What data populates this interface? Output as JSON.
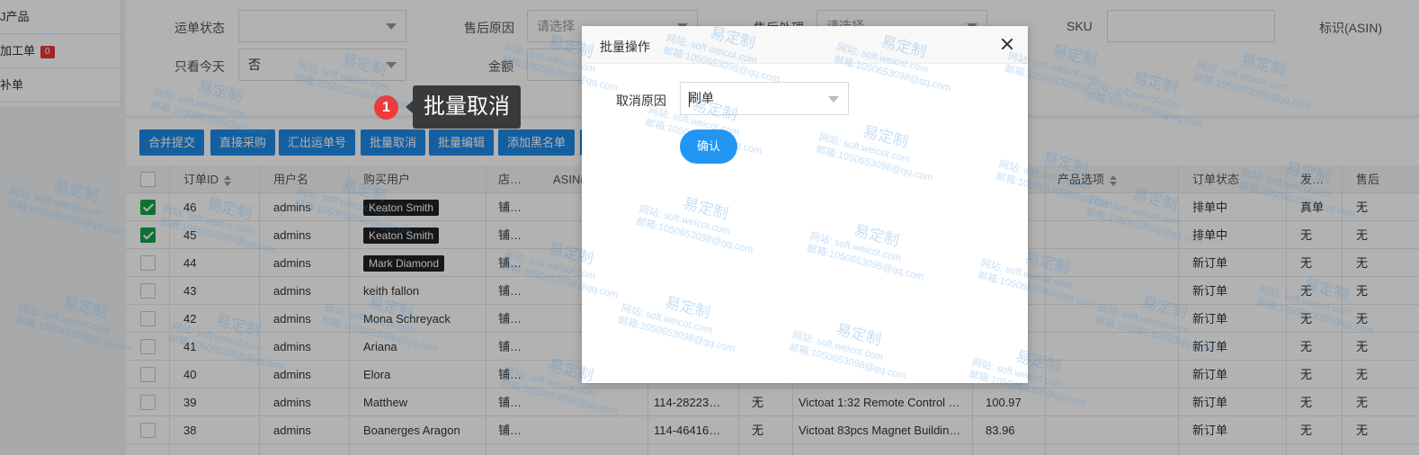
{
  "sidebar": {
    "items": [
      {
        "label": "J产品"
      },
      {
        "label": "加工单",
        "badge": "0"
      },
      {
        "label": "补单"
      }
    ]
  },
  "filters": {
    "waybill_status_label": "运单状态",
    "waybill_status_value": "",
    "aftersale_reason_label": "售后原因",
    "aftersale_reason_placeholder": "请选择",
    "aftersale_handle_label": "售后处理",
    "aftersale_handle_placeholder": "请选择",
    "sku_label": "SKU",
    "asin_label": "标识(ASIN)",
    "today_only_label": "只看今天",
    "today_only_value": "否",
    "amount_label": "金额"
  },
  "toolbar": {
    "buttons": [
      "合并提交",
      "直接采购",
      "汇出运单号",
      "批量取消",
      "批量编辑",
      "添加黑名单"
    ]
  },
  "table": {
    "headers": {
      "order_id": "订单ID",
      "user": "用户名",
      "buyer": "购买用户",
      "store": "店…",
      "asin": "ASIN(",
      "option": "产品选项",
      "status": "订单状态",
      "ship": "发…",
      "aftersale": "售后"
    },
    "rows": [
      {
        "checked": true,
        "id": "46",
        "user": "admins",
        "buyer": "Keaton Smith",
        "tagged": true,
        "store": "铺…",
        "amz": "",
        "aft": "",
        "product": "",
        "price": "",
        "status": "排单中",
        "ship": "真单",
        "after": "无"
      },
      {
        "checked": true,
        "id": "45",
        "user": "admins",
        "buyer": "Keaton Smith",
        "tagged": true,
        "store": "铺…",
        "amz": "",
        "aft": "",
        "product": "",
        "price": "",
        "status": "排单中",
        "ship": "无",
        "after": "无"
      },
      {
        "checked": false,
        "id": "44",
        "user": "admins",
        "buyer": "Mark Diamond",
        "tagged": true,
        "store": "铺…",
        "amz": "",
        "aft": "",
        "product": "",
        "price": "",
        "status": "新订单",
        "ship": "无",
        "after": "无"
      },
      {
        "checked": false,
        "id": "43",
        "user": "admins",
        "buyer": "keith fallon",
        "tagged": false,
        "store": "铺…",
        "amz": "",
        "aft": "",
        "product": "",
        "price": "",
        "status": "新订单",
        "ship": "无",
        "after": "无"
      },
      {
        "checked": false,
        "id": "42",
        "user": "admins",
        "buyer": "Mona Schreyack",
        "tagged": false,
        "store": "铺…",
        "amz": "",
        "aft": "",
        "product": "",
        "price": "",
        "status": "新订单",
        "ship": "无",
        "after": "无"
      },
      {
        "checked": false,
        "id": "41",
        "user": "admins",
        "buyer": "Ariana",
        "tagged": false,
        "store": "铺…",
        "amz": "",
        "aft": "",
        "product": "",
        "price": "",
        "status": "新订单",
        "ship": "无",
        "after": "无"
      },
      {
        "checked": false,
        "id": "40",
        "user": "admins",
        "buyer": "Elora",
        "tagged": false,
        "store": "铺…",
        "amz": "",
        "aft": "",
        "product": "",
        "price": "",
        "status": "新订单",
        "ship": "无",
        "after": "无"
      },
      {
        "checked": false,
        "id": "39",
        "user": "admins",
        "buyer": "Matthew",
        "tagged": false,
        "store": "铺…",
        "amz": "114-28223…",
        "aft": "无",
        "product": "Victoat 1:32 Remote Control …",
        "price": "100.97",
        "status": "新订单",
        "ship": "无",
        "after": "无"
      },
      {
        "checked": false,
        "id": "38",
        "user": "admins",
        "buyer": "Boanerges Aragon",
        "tagged": false,
        "store": "铺…",
        "amz": "114-46416…",
        "aft": "无",
        "product": "Victoat 83pcs Magnet Buildin…",
        "price": "83.96",
        "status": "新订单",
        "ship": "无",
        "after": "无"
      }
    ]
  },
  "tooltip": {
    "step": "1",
    "text": "批量取消"
  },
  "modal": {
    "title": "批量操作",
    "reason_label": "取消原因",
    "reason_value": "刷单",
    "confirm_label": "确认"
  },
  "watermark": {
    "brand": "易定制",
    "site": "网站: soft.weicot.com",
    "mail": "邮箱:1050653098@qq.com"
  },
  "colors": {
    "primary_button": "#1e88e5",
    "confirm_button": "#2196f3",
    "checkbox_checked": "#16a34a",
    "badge": "#e53935",
    "step_marker": "#f03a3a"
  }
}
